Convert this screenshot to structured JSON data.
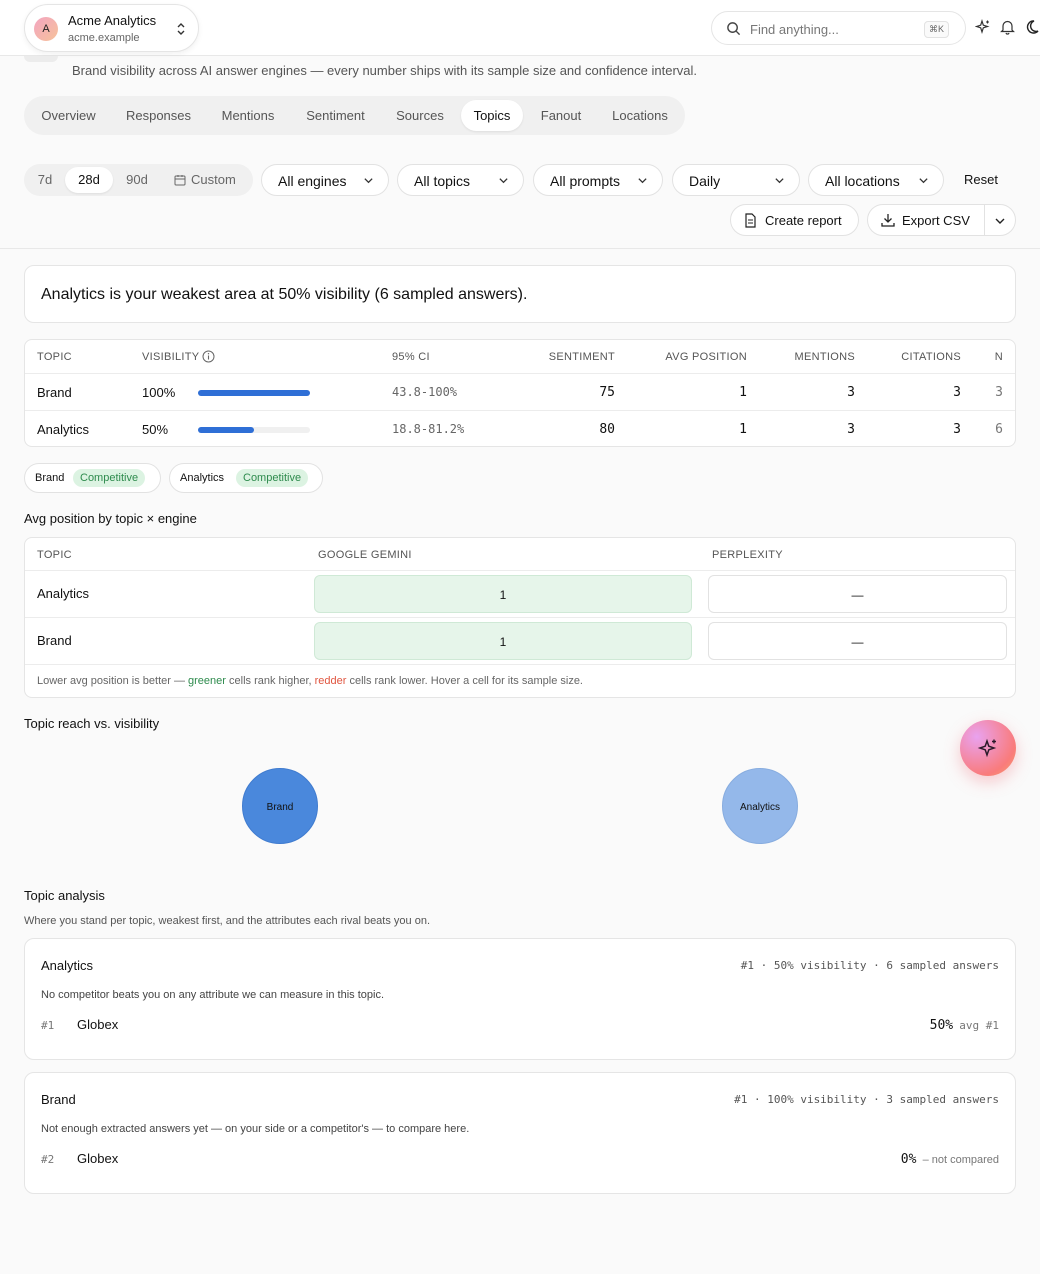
{
  "header": {
    "org_initial": "A",
    "org_name": "Acme Analytics",
    "org_domain": "acme.example",
    "search_placeholder": "Find anything...",
    "search_shortcut": "⌘K"
  },
  "page": {
    "subtitle": "Brand visibility across AI answer engines — every number ships with its sample size and confidence interval."
  },
  "tabs": [
    {
      "label": "Overview"
    },
    {
      "label": "Responses"
    },
    {
      "label": "Mentions"
    },
    {
      "label": "Sentiment"
    },
    {
      "label": "Sources"
    },
    {
      "label": "Topics",
      "active": true
    },
    {
      "label": "Fanout"
    },
    {
      "label": "Locations"
    }
  ],
  "filters": {
    "ranges": [
      {
        "label": "7d"
      },
      {
        "label": "28d",
        "active": true
      },
      {
        "label": "90d"
      },
      {
        "label": "Custom"
      }
    ],
    "dropdowns": [
      {
        "label": "All engines"
      },
      {
        "label": "All topics"
      },
      {
        "label": "All prompts"
      },
      {
        "label": "Daily"
      },
      {
        "label": "All locations"
      }
    ],
    "reset_label": "Reset",
    "create_report_label": "Create report",
    "export_csv_label": "Export CSV"
  },
  "insight": {
    "topic": "Analytics",
    "text_a": " is your weakest area at ",
    "value": "50%",
    "text_b": " visibility (6 sampled answers)."
  },
  "topic_table": {
    "headers": {
      "topic": "TOPIC",
      "visibility": "VISIBILITY",
      "ci": "95% CI",
      "sentiment": "SENTIMENT",
      "avg_position": "AVG POSITION",
      "mentions": "MENTIONS",
      "citations": "CITATIONS",
      "n": "N"
    },
    "rows": [
      {
        "topic": "Brand",
        "visibility": "100%",
        "visibility_fraction": 1.0,
        "ci": "43.8-100%",
        "sentiment": "75",
        "avg_position": "1",
        "mentions": "3",
        "citations": "3",
        "n": "3"
      },
      {
        "topic": "Analytics",
        "visibility": "50%",
        "visibility_fraction": 0.5,
        "ci": "18.8-81.2%",
        "sentiment": "80",
        "avg_position": "1",
        "mentions": "3",
        "citations": "3",
        "n": "6"
      }
    ]
  },
  "chips": [
    {
      "label": "Brand",
      "badge": "Competitive"
    },
    {
      "label": "Analytics",
      "badge": "Competitive"
    }
  ],
  "position_grid": {
    "title": "Avg position by topic × engine",
    "headers": [
      "TOPIC",
      "GOOGLE GEMINI",
      "PERPLEXITY"
    ],
    "rows": [
      {
        "topic": "Analytics",
        "gemini": "1",
        "perplexity": "—"
      },
      {
        "topic": "Brand",
        "gemini": "1",
        "perplexity": "—"
      }
    ],
    "note_a": "Lower avg position is better — ",
    "note_green": "greener",
    "note_b": " cells rank higher, ",
    "note_red": "redder",
    "note_c": " cells rank lower. Hover a cell for its sample size."
  },
  "reach_chart": {
    "title": "Topic reach vs. visibility",
    "bubbles": [
      {
        "label": "Brand",
        "color": "#4a88dc"
      },
      {
        "label": "Analytics",
        "color": "#94b8ea"
      }
    ]
  },
  "analysis": {
    "title": "Topic analysis",
    "subtitle": "Where you stand per topic, weakest first, and the attributes each rival beats you on.",
    "cards": [
      {
        "topic": "Analytics",
        "meta": "#1 · 50% visibility · 6 sampled answers",
        "desc": "No competitor beats you on any attribute we can measure in this topic.",
        "rank": "#1",
        "rival": "Globex",
        "value": "50%",
        "value_note": "avg #1"
      },
      {
        "topic": "Brand",
        "meta": "#1 · 100% visibility · 3 sampled answers",
        "desc": "Not enough extracted answers yet — on your side or a competitor's — to compare here.",
        "rank": "#2",
        "rival": "Globex",
        "value": "0%",
        "value_note": "–  not compared"
      }
    ]
  },
  "colors": {
    "accent_blue": "#2f6fd6",
    "competitive_green": "#2e8b4d",
    "red_note": "#e0553f"
  }
}
